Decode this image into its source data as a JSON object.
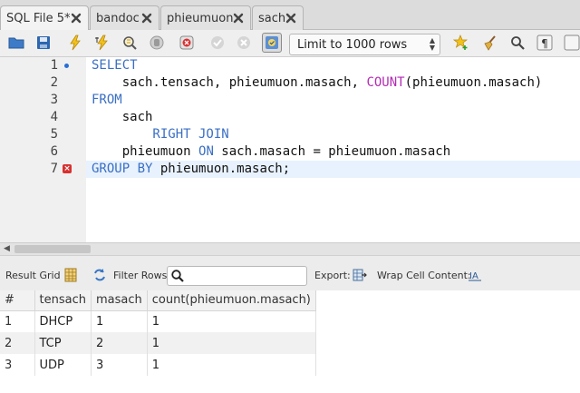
{
  "tabs": [
    {
      "label": "SQL File 5*",
      "active": true
    },
    {
      "label": "bandoc",
      "active": false
    },
    {
      "label": "phieumuon",
      "active": false
    },
    {
      "label": "sach",
      "active": false
    }
  ],
  "toolbar": {
    "limit_value": "Limit to 1000 rows",
    "icons": [
      "open-file-icon",
      "save-icon",
      "execute-icon",
      "execute-current-icon",
      "explain-icon",
      "stop-icon",
      "toggle-error-icon",
      "commit-icon",
      "rollback-icon",
      "autocommit-icon",
      "limit-select",
      "favorite-icon",
      "beautify-icon",
      "find-icon",
      "invisible-chars-icon",
      "wrap-icon"
    ]
  },
  "editor": {
    "lines": [
      {
        "num": "1",
        "marker": "dot"
      },
      {
        "num": "2",
        "marker": ""
      },
      {
        "num": "3",
        "marker": ""
      },
      {
        "num": "4",
        "marker": ""
      },
      {
        "num": "5",
        "marker": ""
      },
      {
        "num": "6",
        "marker": ""
      },
      {
        "num": "7",
        "marker": "error"
      }
    ],
    "tokens": {
      "l1_kw": "SELECT",
      "l2_a": "    sach.tensach, phieumuon.masach, ",
      "l2_fn": "COUNT",
      "l2_b": "(phieumuon.masach)",
      "l3_kw": "FROM",
      "l4_a": "    sach",
      "l5_kw": "        RIGHT JOIN",
      "l6_a": "    phieumuon ",
      "l6_kw": "ON",
      "l6_b": " sach.masach = phieumuon.masach",
      "l7_kw": "GROUP BY",
      "l7_a": " phieumuon.masach;"
    },
    "error_mark": "×"
  },
  "result_toolbar": {
    "result_grid": "Result Grid",
    "filter_rows": "Filter Rows:",
    "filter_value": "",
    "export": "Export:",
    "wrap": "Wrap Cell Content:"
  },
  "grid": {
    "columns": [
      "#",
      "tensach",
      "masach",
      "count(phieumuon.masach)"
    ],
    "rows": [
      [
        "1",
        "DHCP",
        "1",
        "1"
      ],
      [
        "2",
        "TCP",
        "2",
        "1"
      ],
      [
        "3",
        "UDP",
        "3",
        "1"
      ]
    ]
  },
  "colors": {
    "keyword": "#3a6fc4",
    "function": "#b52bb5",
    "current_line": "#e8f2fe",
    "error": "#d93030"
  }
}
